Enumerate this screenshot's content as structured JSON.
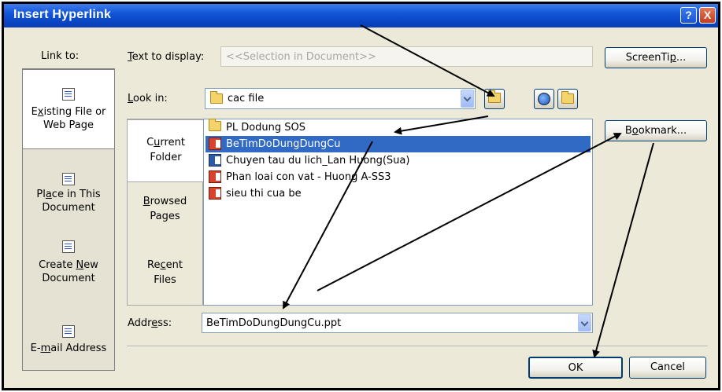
{
  "dialog": {
    "title": "Insert Hyperlink",
    "help_glyph": "?",
    "close_glyph": "X"
  },
  "link_to": {
    "label": "Link to:",
    "items": [
      {
        "line1_pre": "E",
        "line1_ul": "x",
        "line1_post": "isting File or",
        "line2": "Web Page"
      },
      {
        "line1_pre": "Pl",
        "line1_ul": "a",
        "line1_post": "ce in This",
        "line2": "Document"
      },
      {
        "line1_pre": "Create ",
        "line1_ul": "N",
        "line1_post": "ew",
        "line2": "Document"
      },
      {
        "line1_pre": "E-",
        "line1_ul": "m",
        "line1_post": "ail Address",
        "line2": ""
      }
    ]
  },
  "text_to_display": {
    "label_ul": "T",
    "label_rest": "ext to display:",
    "value": "<<Selection in Document>>"
  },
  "screentip_button": {
    "pre": "ScreenTi",
    "ul": "p",
    "post": "..."
  },
  "look_in": {
    "label_ul": "L",
    "label_rest": "ook in:",
    "value": "cac file"
  },
  "side_tabs": [
    {
      "l1_pre": "C",
      "l1_ul": "u",
      "l1_post": "rrent",
      "l2": "Folder"
    },
    {
      "l1_pre": "",
      "l1_ul": "B",
      "l1_post": "rowsed",
      "l2": "Pages"
    },
    {
      "l1_pre": "Re",
      "l1_ul": "c",
      "l1_post": "ent",
      "l2": "Files"
    }
  ],
  "files": [
    {
      "name": "PL Dodung SOS",
      "icon": "folder-icon"
    },
    {
      "name": "BeTimDoDungDungCu",
      "icon": "powerpoint-file-icon"
    },
    {
      "name": "Chuyen tau du lich_Lan Huong(Sua)",
      "icon": "word-file-icon"
    },
    {
      "name": "Phan loai con vat - Huong A-SS3",
      "icon": "powerpoint-file-icon"
    },
    {
      "name": "sieu thi cua be",
      "icon": "powerpoint-file-icon"
    }
  ],
  "bookmark_button": {
    "pre": "B",
    "ul": "o",
    "post": "okmark..."
  },
  "address": {
    "label_pre": "Addr",
    "label_ul": "e",
    "label_post": "ss:",
    "value": "BeTimDoDungDungCu.ppt"
  },
  "ok_button": {
    "label": "OK"
  },
  "cancel_button": {
    "label": "Cancel"
  },
  "colors": {
    "selection": "#316ac5",
    "titlebar": "#0a45c4",
    "dialog_bg": "#ece9d8",
    "annotation_arrows": "#000000"
  }
}
